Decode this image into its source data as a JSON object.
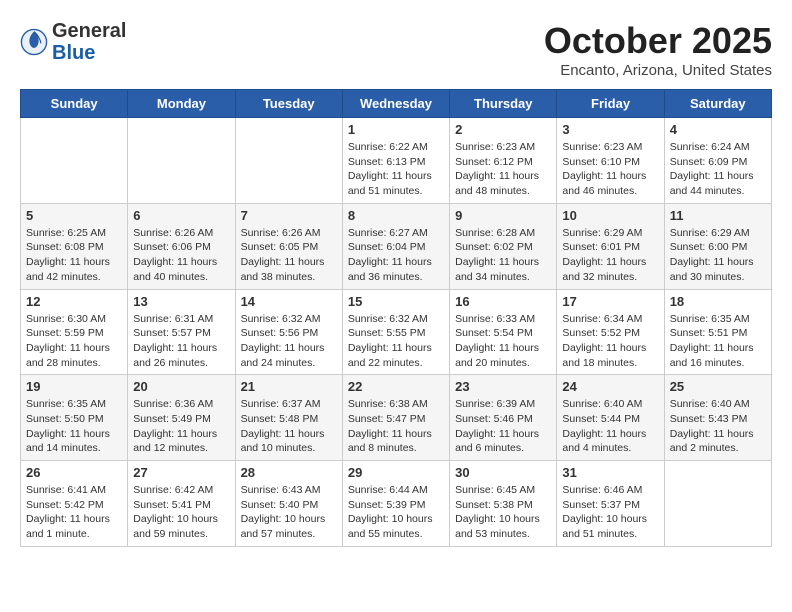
{
  "header": {
    "logo_line1": "General",
    "logo_line2": "Blue",
    "month_title": "October 2025",
    "location": "Encanto, Arizona, United States"
  },
  "weekdays": [
    "Sunday",
    "Monday",
    "Tuesday",
    "Wednesday",
    "Thursday",
    "Friday",
    "Saturday"
  ],
  "weeks": [
    [
      {
        "day": "",
        "info": ""
      },
      {
        "day": "",
        "info": ""
      },
      {
        "day": "",
        "info": ""
      },
      {
        "day": "1",
        "info": "Sunrise: 6:22 AM\nSunset: 6:13 PM\nDaylight: 11 hours\nand 51 minutes."
      },
      {
        "day": "2",
        "info": "Sunrise: 6:23 AM\nSunset: 6:12 PM\nDaylight: 11 hours\nand 48 minutes."
      },
      {
        "day": "3",
        "info": "Sunrise: 6:23 AM\nSunset: 6:10 PM\nDaylight: 11 hours\nand 46 minutes."
      },
      {
        "day": "4",
        "info": "Sunrise: 6:24 AM\nSunset: 6:09 PM\nDaylight: 11 hours\nand 44 minutes."
      }
    ],
    [
      {
        "day": "5",
        "info": "Sunrise: 6:25 AM\nSunset: 6:08 PM\nDaylight: 11 hours\nand 42 minutes."
      },
      {
        "day": "6",
        "info": "Sunrise: 6:26 AM\nSunset: 6:06 PM\nDaylight: 11 hours\nand 40 minutes."
      },
      {
        "day": "7",
        "info": "Sunrise: 6:26 AM\nSunset: 6:05 PM\nDaylight: 11 hours\nand 38 minutes."
      },
      {
        "day": "8",
        "info": "Sunrise: 6:27 AM\nSunset: 6:04 PM\nDaylight: 11 hours\nand 36 minutes."
      },
      {
        "day": "9",
        "info": "Sunrise: 6:28 AM\nSunset: 6:02 PM\nDaylight: 11 hours\nand 34 minutes."
      },
      {
        "day": "10",
        "info": "Sunrise: 6:29 AM\nSunset: 6:01 PM\nDaylight: 11 hours\nand 32 minutes."
      },
      {
        "day": "11",
        "info": "Sunrise: 6:29 AM\nSunset: 6:00 PM\nDaylight: 11 hours\nand 30 minutes."
      }
    ],
    [
      {
        "day": "12",
        "info": "Sunrise: 6:30 AM\nSunset: 5:59 PM\nDaylight: 11 hours\nand 28 minutes."
      },
      {
        "day": "13",
        "info": "Sunrise: 6:31 AM\nSunset: 5:57 PM\nDaylight: 11 hours\nand 26 minutes."
      },
      {
        "day": "14",
        "info": "Sunrise: 6:32 AM\nSunset: 5:56 PM\nDaylight: 11 hours\nand 24 minutes."
      },
      {
        "day": "15",
        "info": "Sunrise: 6:32 AM\nSunset: 5:55 PM\nDaylight: 11 hours\nand 22 minutes."
      },
      {
        "day": "16",
        "info": "Sunrise: 6:33 AM\nSunset: 5:54 PM\nDaylight: 11 hours\nand 20 minutes."
      },
      {
        "day": "17",
        "info": "Sunrise: 6:34 AM\nSunset: 5:52 PM\nDaylight: 11 hours\nand 18 minutes."
      },
      {
        "day": "18",
        "info": "Sunrise: 6:35 AM\nSunset: 5:51 PM\nDaylight: 11 hours\nand 16 minutes."
      }
    ],
    [
      {
        "day": "19",
        "info": "Sunrise: 6:35 AM\nSunset: 5:50 PM\nDaylight: 11 hours\nand 14 minutes."
      },
      {
        "day": "20",
        "info": "Sunrise: 6:36 AM\nSunset: 5:49 PM\nDaylight: 11 hours\nand 12 minutes."
      },
      {
        "day": "21",
        "info": "Sunrise: 6:37 AM\nSunset: 5:48 PM\nDaylight: 11 hours\nand 10 minutes."
      },
      {
        "day": "22",
        "info": "Sunrise: 6:38 AM\nSunset: 5:47 PM\nDaylight: 11 hours\nand 8 minutes."
      },
      {
        "day": "23",
        "info": "Sunrise: 6:39 AM\nSunset: 5:46 PM\nDaylight: 11 hours\nand 6 minutes."
      },
      {
        "day": "24",
        "info": "Sunrise: 6:40 AM\nSunset: 5:44 PM\nDaylight: 11 hours\nand 4 minutes."
      },
      {
        "day": "25",
        "info": "Sunrise: 6:40 AM\nSunset: 5:43 PM\nDaylight: 11 hours\nand 2 minutes."
      }
    ],
    [
      {
        "day": "26",
        "info": "Sunrise: 6:41 AM\nSunset: 5:42 PM\nDaylight: 11 hours\nand 1 minute."
      },
      {
        "day": "27",
        "info": "Sunrise: 6:42 AM\nSunset: 5:41 PM\nDaylight: 10 hours\nand 59 minutes."
      },
      {
        "day": "28",
        "info": "Sunrise: 6:43 AM\nSunset: 5:40 PM\nDaylight: 10 hours\nand 57 minutes."
      },
      {
        "day": "29",
        "info": "Sunrise: 6:44 AM\nSunset: 5:39 PM\nDaylight: 10 hours\nand 55 minutes."
      },
      {
        "day": "30",
        "info": "Sunrise: 6:45 AM\nSunset: 5:38 PM\nDaylight: 10 hours\nand 53 minutes."
      },
      {
        "day": "31",
        "info": "Sunrise: 6:46 AM\nSunset: 5:37 PM\nDaylight: 10 hours\nand 51 minutes."
      },
      {
        "day": "",
        "info": ""
      }
    ]
  ]
}
